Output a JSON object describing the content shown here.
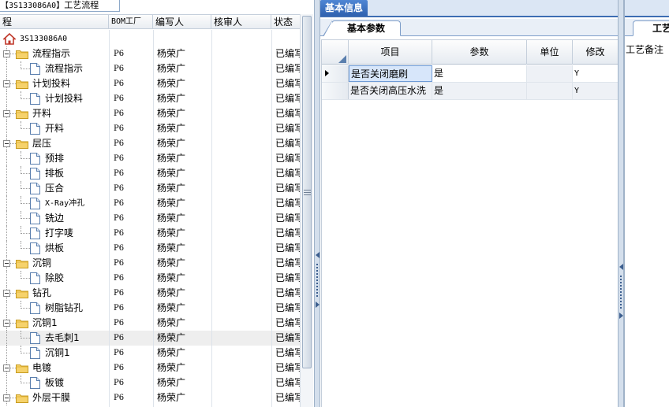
{
  "document_tab": {
    "code": "【3S133086A0】",
    "label": "工艺流程"
  },
  "tree": {
    "columns": {
      "process": "程",
      "bom_factory": "BOM工厂",
      "author": "编写人",
      "reviewer": "核审人",
      "status": "状态"
    },
    "root_label": "3S133086A0",
    "rows": [
      {
        "label": "流程指示",
        "factory": "P6",
        "author": "杨荣广",
        "reviewer": "",
        "status": "已编写"
      },
      {
        "label": "流程指示",
        "factory": "P6",
        "author": "杨荣广",
        "reviewer": "",
        "status": "已编写"
      },
      {
        "label": "计划投料",
        "factory": "P6",
        "author": "杨荣广",
        "reviewer": "",
        "status": "已编写"
      },
      {
        "label": "计划投料",
        "factory": "P6",
        "author": "杨荣广",
        "reviewer": "",
        "status": "已编写"
      },
      {
        "label": "开料",
        "factory": "P6",
        "author": "杨荣广",
        "reviewer": "",
        "status": "已编写"
      },
      {
        "label": "开料",
        "factory": "P6",
        "author": "杨荣广",
        "reviewer": "",
        "status": "已编写"
      },
      {
        "label": "层压",
        "factory": "P6",
        "author": "杨荣广",
        "reviewer": "",
        "status": "已编写"
      },
      {
        "label": "预排",
        "factory": "P6",
        "author": "杨荣广",
        "reviewer": "",
        "status": "已编写"
      },
      {
        "label": "排板",
        "factory": "P6",
        "author": "杨荣广",
        "reviewer": "",
        "status": "已编写"
      },
      {
        "label": "压合",
        "factory": "P6",
        "author": "杨荣广",
        "reviewer": "",
        "status": "已编写"
      },
      {
        "label": "X-Ray冲孔",
        "factory": "P6",
        "author": "杨荣广",
        "reviewer": "",
        "status": "已编写"
      },
      {
        "label": "铣边",
        "factory": "P6",
        "author": "杨荣广",
        "reviewer": "",
        "status": "已编写"
      },
      {
        "label": "打字唛",
        "factory": "P6",
        "author": "杨荣广",
        "reviewer": "",
        "status": "已编写"
      },
      {
        "label": "烘板",
        "factory": "P6",
        "author": "杨荣广",
        "reviewer": "",
        "status": "已编写"
      },
      {
        "label": "沉铜",
        "factory": "P6",
        "author": "杨荣广",
        "reviewer": "",
        "status": "已编写"
      },
      {
        "label": "除胶",
        "factory": "P6",
        "author": "杨荣广",
        "reviewer": "",
        "status": "已编写"
      },
      {
        "label": "钻孔",
        "factory": "P6",
        "author": "杨荣广",
        "reviewer": "",
        "status": "已编写"
      },
      {
        "label": "树脂钻孔",
        "factory": "P6",
        "author": "杨荣广",
        "reviewer": "",
        "status": "已编写"
      },
      {
        "label": "沉铜1",
        "factory": "P6",
        "author": "杨荣广",
        "reviewer": "",
        "status": "已编写"
      },
      {
        "label": "去毛刺1",
        "factory": "P6",
        "author": "杨荣广",
        "reviewer": "",
        "status": "已编写"
      },
      {
        "label": "沉铜1",
        "factory": "P6",
        "author": "杨荣广",
        "reviewer": "",
        "status": "已编写"
      },
      {
        "label": "电镀",
        "factory": "P6",
        "author": "杨荣广",
        "reviewer": "",
        "status": "已编写"
      },
      {
        "label": "板镀",
        "factory": "P6",
        "author": "杨荣广",
        "reviewer": "",
        "status": "已编写"
      },
      {
        "label": "外层干膜",
        "factory": "P6",
        "author": "杨荣广",
        "reviewer": "",
        "status": "已编写"
      }
    ]
  },
  "main_tab": "基本信息",
  "sub_tab": "基本参数",
  "params_grid": {
    "columns": {
      "item": "项目",
      "param": "参数",
      "unit": "单位",
      "modify": "修改"
    },
    "rows": [
      {
        "item": "是否关闭磨刷",
        "param": "是",
        "unit": "",
        "modify": "Y"
      },
      {
        "item": "是否关闭高压水洗",
        "param": "是",
        "unit": "",
        "modify": "Y"
      }
    ]
  },
  "right_panel": {
    "tab_label": "工艺",
    "remark_label": "工艺备注"
  }
}
